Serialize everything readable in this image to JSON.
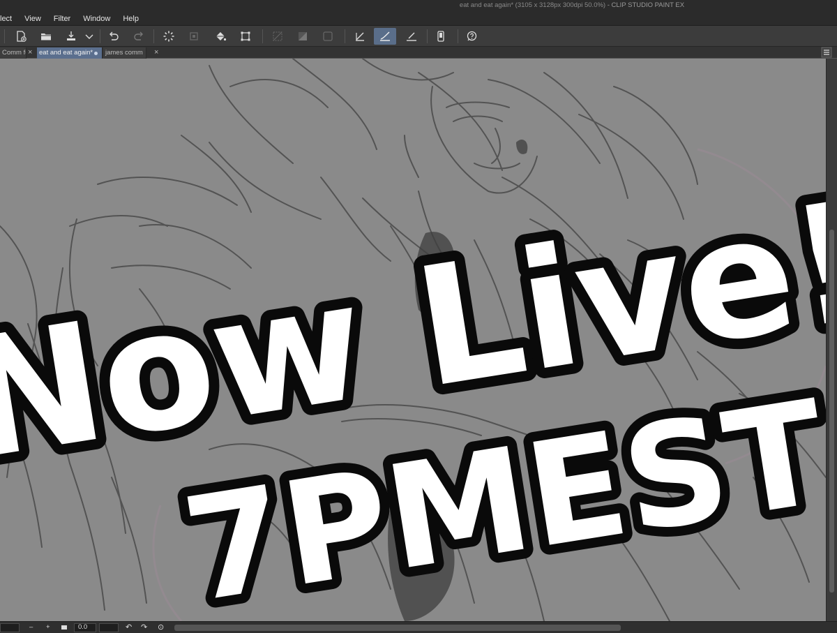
{
  "window": {
    "title": "eat and eat again* (3105 x 3128px 300dpi 50.0%)",
    "app_name": "- CLIP STUDIO PAINT EX"
  },
  "menu": {
    "items": [
      "lect",
      "View",
      "Filter",
      "Window",
      "Help"
    ]
  },
  "toolbar": {
    "icons": [
      "new-canvas-icon",
      "open-icon",
      "save-icon",
      "save-dropdown-icon",
      "undo-icon",
      "redo-icon",
      "loading-icon",
      "clear-icon",
      "fill-icon",
      "transform-icon",
      "deselect-icon",
      "invert-selection-icon",
      "show-selection-icon",
      "snap-ruler-icon",
      "snap-special-ruler-icon",
      "snap-grid-icon",
      "device-icon",
      "help-icon"
    ],
    "active_icon": "snap-special-ruler-icon"
  },
  "tabs": [
    {
      "label": "Comm fo",
      "active": false,
      "modified": false
    },
    {
      "label": "eat and eat again*",
      "active": true,
      "modified": true
    },
    {
      "label": "james comm",
      "active": false,
      "modified": false
    }
  ],
  "canvas": {
    "overlay_line1": "Now Live!",
    "overlay_line2": "7PMEST",
    "background_color": "#8a8a8a"
  },
  "statusbar": {
    "zoom_value": "0.0",
    "minus_label": "–",
    "plus_label": "+"
  },
  "colors": {
    "accent": "#5b6f8e",
    "menubar": "#2b2b2b",
    "toolbar": "#3c3c3c"
  }
}
